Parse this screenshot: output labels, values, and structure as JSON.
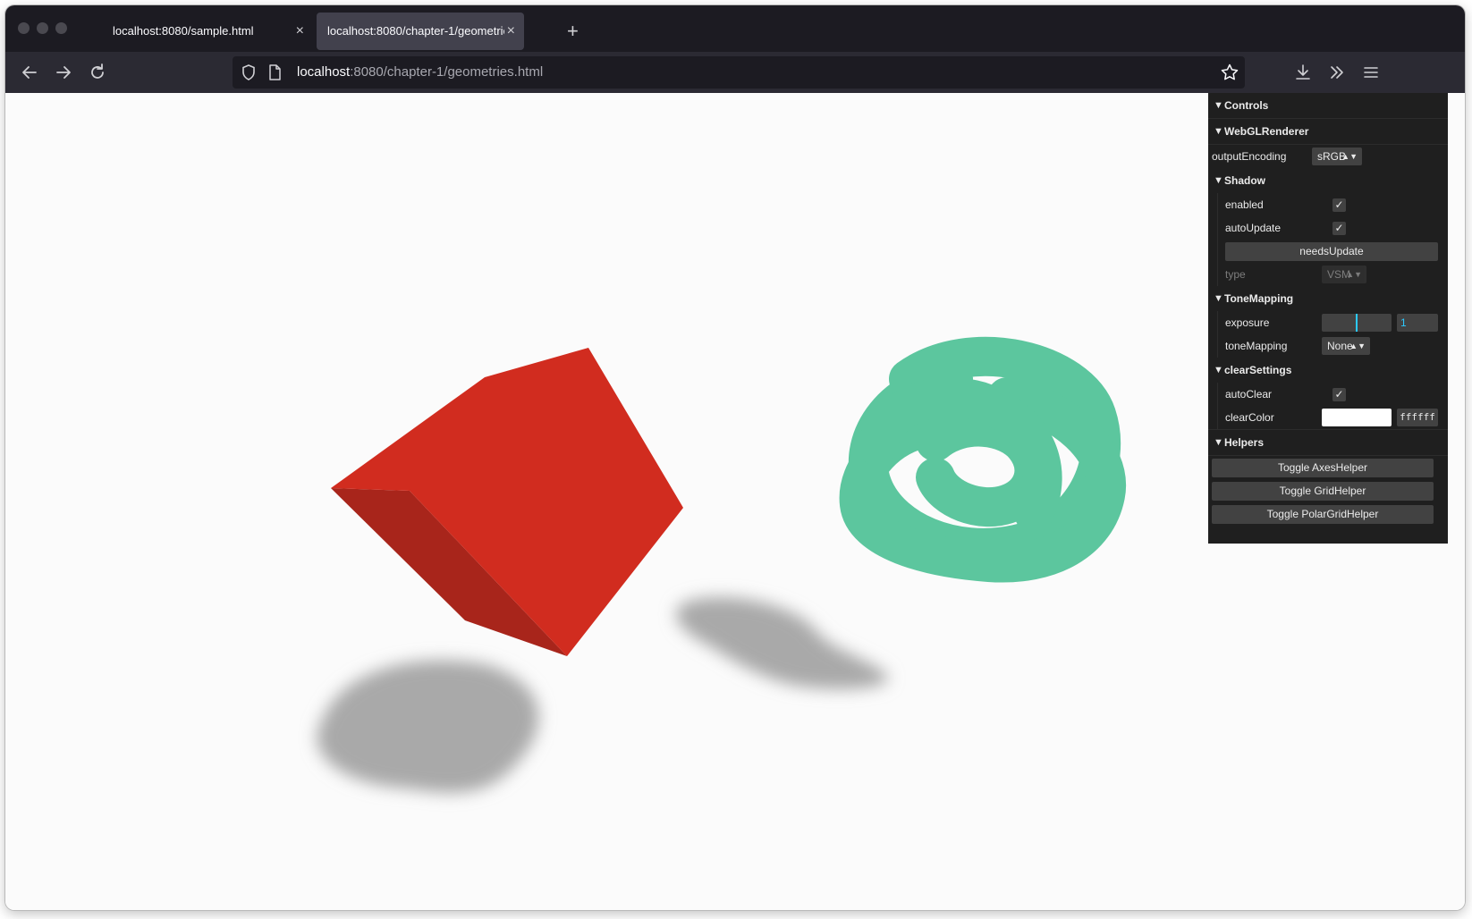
{
  "browser": {
    "tabs": [
      {
        "label": "localhost:8080/sample.html",
        "active": false
      },
      {
        "label": "localhost:8080/chapter-1/geometries.html",
        "active": true
      }
    ],
    "new_tab_label": "+",
    "close_label": "×",
    "url_host": "localhost",
    "url_rest": ":8080/chapter-1/geometries.html"
  },
  "gui": {
    "controls_title": "Controls",
    "webgl_title": "WebGLRenderer",
    "output_encoding_label": "outputEncoding",
    "output_encoding_value": "sRGB",
    "shadow_title": "Shadow",
    "enabled_label": "enabled",
    "enabled_checked": true,
    "auto_update_label": "autoUpdate",
    "auto_update_checked": true,
    "needs_update_label": "needsUpdate",
    "type_label": "type",
    "type_value": "VSM",
    "tone_title": "ToneMapping",
    "exposure_label": "exposure",
    "exposure_value": "1",
    "tone_mapping_label": "toneMapping",
    "tone_mapping_value": "None",
    "clear_title": "clearSettings",
    "auto_clear_label": "autoClear",
    "auto_clear_checked": true,
    "clear_color_label": "clearColor",
    "clear_color_value": "ffffff",
    "helpers_title": "Helpers",
    "helper_buttons": [
      "Toggle AxesHelper",
      "Toggle GridHelper",
      "Toggle PolarGridHelper"
    ]
  },
  "colors": {
    "cube_top": "#d12c1f",
    "cube_side": "#a8251b",
    "knot": "#5cc69e",
    "shadow": "#a9a9a9",
    "slider_accent": "#2cc9ff"
  }
}
